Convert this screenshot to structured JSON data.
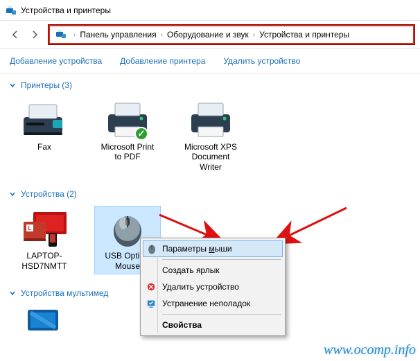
{
  "window": {
    "title": "Устройства и принтеры"
  },
  "breadcrumb": {
    "items": [
      "Панель управления",
      "Оборудование и звук",
      "Устройства и принтеры"
    ]
  },
  "commands": {
    "add_device": "Добавление устройства",
    "add_printer": "Добавление принтера",
    "delete_device": "Удалить устройство"
  },
  "groups": {
    "printers": {
      "header": "Принтеры (3)",
      "items": [
        {
          "label": "Fax",
          "icon": "fax"
        },
        {
          "label": "Microsoft Print to PDF",
          "icon": "printer",
          "default": true
        },
        {
          "label": "Microsoft XPS Document Writer",
          "icon": "printer"
        }
      ]
    },
    "devices": {
      "header": "Устройства (2)",
      "items": [
        {
          "label": "LAPTOP-HSD7NMTT",
          "icon": "laptop"
        },
        {
          "label": "USB Optical Mouse",
          "icon": "mouse",
          "selected": true
        }
      ]
    },
    "multimedia": {
      "header": "Устройства мультимед"
    }
  },
  "context_menu": {
    "mouse_settings": "Параметры мыши",
    "create_shortcut": "Создать ярлык",
    "remove_device": "Удалить устройство",
    "troubleshoot": "Устранение неполадок",
    "properties": "Свойства"
  },
  "watermark": "www.ocomp.info"
}
